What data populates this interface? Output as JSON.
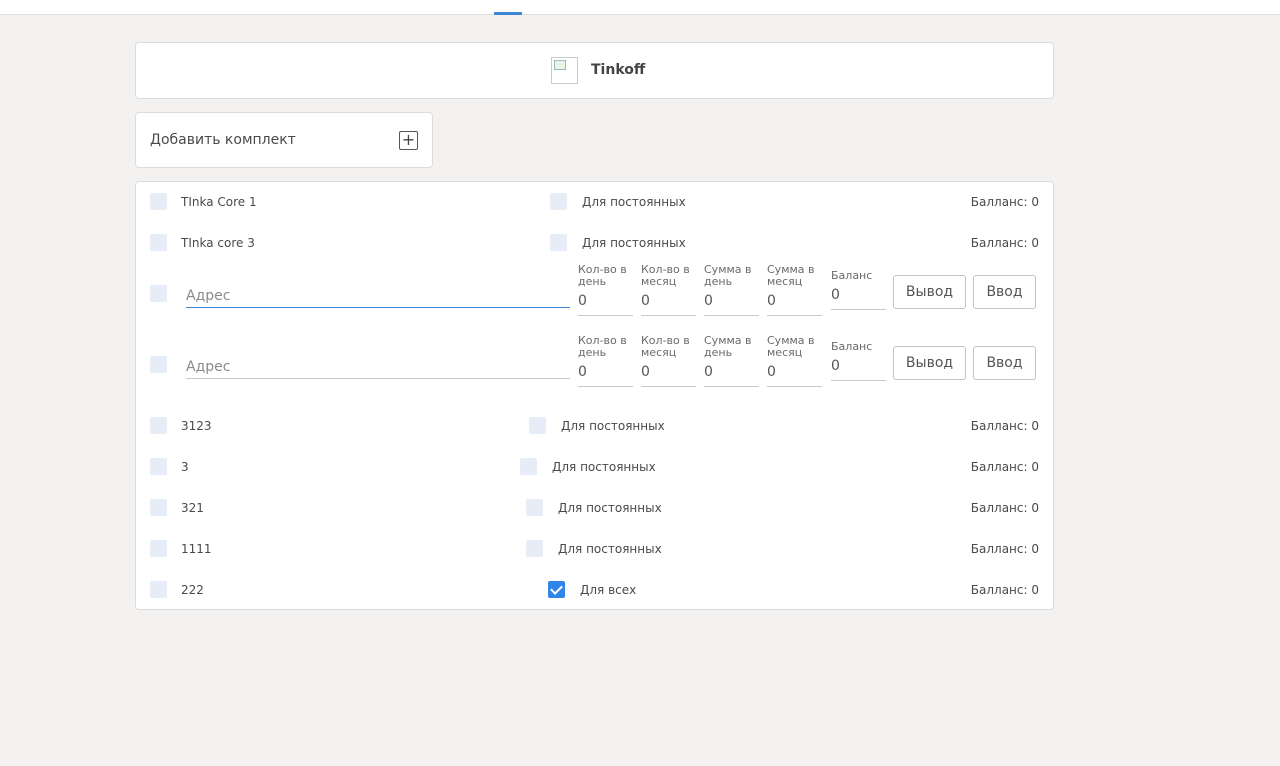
{
  "bank": {
    "name": "Tinkoff",
    "logo_icon": "broken-image-icon"
  },
  "add_kit": {
    "label": "Добавить комплект",
    "icon": "plus-icon"
  },
  "cards": [
    {
      "name": "TInka Core 1",
      "mode": "Для постоянных",
      "balance": "Балланс: 0",
      "checked": false
    },
    {
      "name": "TInka core 3",
      "mode": "Для постоянных",
      "balance": "Балланс: 0",
      "checked": false
    }
  ],
  "wallets": [
    {
      "address_placeholder": "Адрес",
      "fields": [
        {
          "label": "Кол-во в день",
          "value": "0"
        },
        {
          "label": "Кол-во в месяц",
          "value": "0"
        },
        {
          "label": "Сумма в день",
          "value": "0"
        },
        {
          "label": "Сумма в месяц",
          "value": "0"
        }
      ],
      "balance_label": "Баланс",
      "balance_value": "0",
      "withdraw_label": "Вывод",
      "deposit_label": "Ввод"
    },
    {
      "address_placeholder": "Адрес",
      "fields": [
        {
          "label": "Кол-во в день",
          "value": "0"
        },
        {
          "label": "Кол-во в месяц",
          "value": "0"
        },
        {
          "label": "Сумма в день",
          "value": "0"
        },
        {
          "label": "Сумма в месяц",
          "value": "0"
        }
      ],
      "balance_label": "Баланс",
      "balance_value": "0",
      "withdraw_label": "Вывод",
      "deposit_label": "Ввод"
    }
  ],
  "kits": [
    {
      "name": "3123",
      "mode": "Для постоянных",
      "balance": "Балланс: 0",
      "checked": false
    },
    {
      "name": "3",
      "mode": "Для постоянных",
      "balance": "Балланс: 0",
      "checked": false
    },
    {
      "name": "321",
      "mode": "Для постоянных",
      "balance": "Балланс: 0",
      "checked": false
    },
    {
      "name": "1111",
      "mode": "Для постоянных",
      "balance": "Балланс: 0",
      "checked": false
    },
    {
      "name": "222",
      "mode": "Для всех",
      "balance": "Балланс: 0",
      "checked": true
    }
  ],
  "colors": {
    "accent": "#2f86e8",
    "checkbox_bg": "#e7edf6",
    "page_bg": "#f3f2f0"
  }
}
